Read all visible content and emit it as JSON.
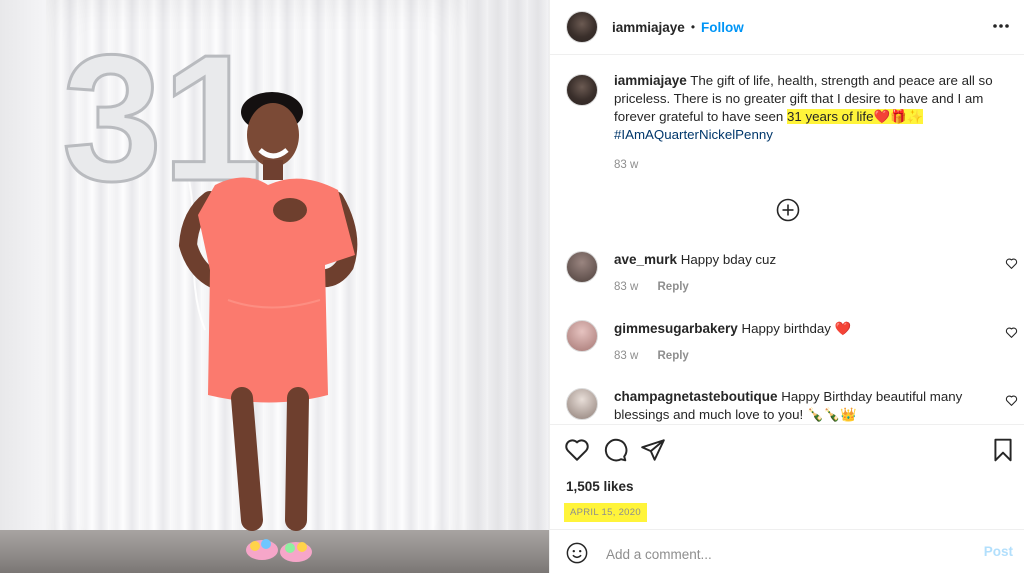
{
  "post": {
    "username": "iammiajaye",
    "dot": "•",
    "follow_label": "Follow",
    "balloon_number": "31"
  },
  "caption": {
    "username": "iammiajaye",
    "text_before": "The gift of life, health, strength and peace are all so priceless. There is no greater gift that I desire to have and I am forever grateful to have seen",
    "highlight": "31 years of life",
    "highlight_emoji": "❤️🎁✨",
    "hashtag": "#IAmAQuarterNickelPenny",
    "age": "83 w"
  },
  "comments": [
    {
      "username": "ave_murk",
      "text": "Happy bday cuz",
      "age": "83 w",
      "reply_label": "Reply",
      "avatar_color": "#7a6a66"
    },
    {
      "username": "gimmesugarbakery",
      "text": "Happy birthday",
      "emoji": "❤️",
      "age": "83 w",
      "reply_label": "Reply",
      "avatar_color": "#c89a98"
    },
    {
      "username": "champagnetasteboutique",
      "text": "Happy Birthday beautiful many blessings and much love to you!",
      "emoji": "🍾🍾👑",
      "avatar_color": "#b9aaa3"
    }
  ],
  "stats": {
    "likes": "1,505 likes",
    "date": "APRIL 15, 2020"
  },
  "composer": {
    "placeholder": "Add a comment...",
    "post_label": "Post"
  },
  "colors": {
    "accent": "#0095f6",
    "hashtag": "#00376b",
    "highlight": "#fff43a",
    "dress": "#fb7a6e",
    "post_disabled": "#b2dffc"
  },
  "icons": [
    "more-icon",
    "load-more-icon",
    "heart-icon",
    "comment-icon",
    "share-icon",
    "bookmark-icon",
    "emoji-icon"
  ]
}
